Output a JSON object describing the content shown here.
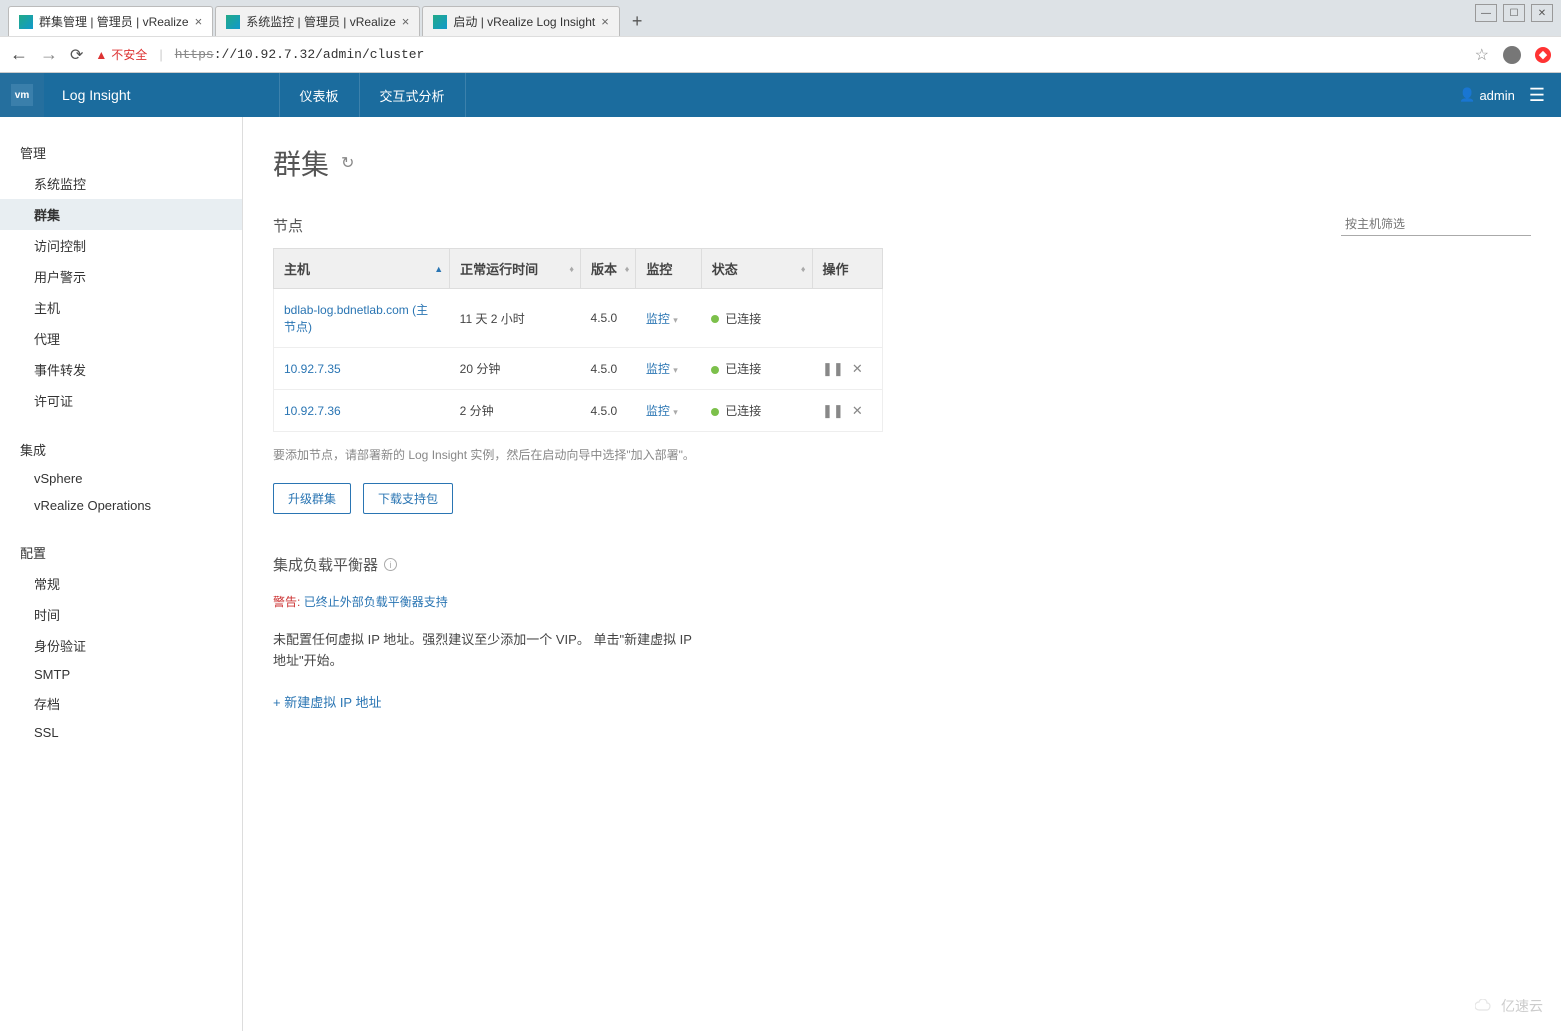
{
  "browser": {
    "tabs": [
      {
        "title": "群集管理 | 管理员 | vRealize",
        "active": true
      },
      {
        "title": "系统监控 | 管理员 | vRealize",
        "active": false
      },
      {
        "title": "启动 | vRealize Log Insight",
        "active": false
      }
    ],
    "insecure_label": "不安全",
    "url_https": "https",
    "url_rest": "://10.92.7.32/admin/cluster"
  },
  "header": {
    "logo_text": "vm",
    "app_title": "Log Insight",
    "nav": {
      "dashboards": "仪表板",
      "interactive": "交互式分析"
    },
    "user": "admin"
  },
  "sidebar": {
    "groups": [
      {
        "title": "管理",
        "items": [
          "系统监控",
          "群集",
          "访问控制",
          "用户警示",
          "主机",
          "代理",
          "事件转发",
          "许可证"
        ],
        "active_index": 1
      },
      {
        "title": "集成",
        "items": [
          "vSphere",
          "vRealize Operations"
        ],
        "active_index": -1
      },
      {
        "title": "配置",
        "items": [
          "常规",
          "时间",
          "身份验证",
          "SMTP",
          "存档",
          "SSL"
        ],
        "active_index": -1
      }
    ]
  },
  "page": {
    "title": "群集",
    "nodes_section": "节点",
    "filter_placeholder": "按主机筛选",
    "columns": {
      "host": "主机",
      "uptime": "正常运行时间",
      "version": "版本",
      "monitor": "监控",
      "status": "状态",
      "actions": "操作"
    },
    "rows": [
      {
        "host": "bdlab-log.bdnetlab.com (主节点)",
        "uptime": "11 天 2 小时",
        "version": "4.5.0",
        "monitor": "监控",
        "status": "已连接",
        "has_actions": false
      },
      {
        "host": "10.92.7.35",
        "uptime": "20 分钟",
        "version": "4.5.0",
        "monitor": "监控",
        "status": "已连接",
        "has_actions": true
      },
      {
        "host": "10.92.7.36",
        "uptime": "2 分钟",
        "version": "4.5.0",
        "monitor": "监控",
        "status": "已连接",
        "has_actions": true
      }
    ],
    "add_note": "要添加节点，请部署新的 Log Insight 实例，然后在启动向导中选择\"加入部署\"。",
    "upgrade_btn": "升级群集",
    "download_btn": "下载支持包",
    "lb_title": "集成负载平衡器",
    "warning_label": "警告:",
    "warning_text": "已终止外部负载平衡器支持",
    "lb_note": "未配置任何虚拟 IP 地址。强烈建议至少添加一个 VIP。 单击\"新建虚拟 IP 地址\"开始。",
    "add_vip": "+ 新建虚拟 IP 地址"
  },
  "watermark": "亿速云"
}
